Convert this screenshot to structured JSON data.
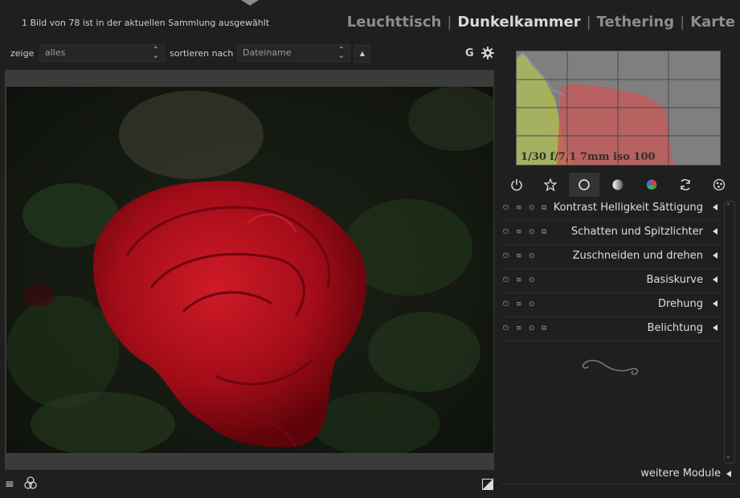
{
  "header": {
    "status": "1 Bild von 78 ist in der aktuellen Sammlung ausgewählt",
    "views": [
      "Leuchttisch",
      "Dunkelkammer",
      "Tethering",
      "Karte"
    ],
    "active_view": "Dunkelkammer",
    "separator": "|"
  },
  "filmstrip_toolbar": {
    "show_label": "zeige",
    "show_value": "alles",
    "sort_label": "sortieren nach",
    "sort_value": "Dateiname",
    "sort_direction": "▲",
    "grouping_label": "G"
  },
  "histogram": {
    "exif": "1/30 f/7,1 7mm iso 100"
  },
  "module_groups": [
    {
      "name": "power-icon"
    },
    {
      "name": "favorites-star-icon"
    },
    {
      "name": "basic-group-circle-icon",
      "active": true
    },
    {
      "name": "tone-group-icon"
    },
    {
      "name": "color-group-icon"
    },
    {
      "name": "correct-group-icon"
    },
    {
      "name": "effects-group-icon"
    }
  ],
  "modules": [
    {
      "name": "Kontrast Helligkeit Sättigung",
      "multi_instance": true
    },
    {
      "name": "Schatten und Spitzlichter",
      "multi_instance": true
    },
    {
      "name": "Zuschneiden und drehen",
      "multi_instance": false
    },
    {
      "name": "Basiskurve",
      "multi_instance": false
    },
    {
      "name": "Drehung",
      "multi_instance": false
    },
    {
      "name": "Belichtung",
      "multi_instance": true
    }
  ],
  "more_modules": "weitere Module",
  "colors": {
    "background": "#1f1f1f",
    "panel_text": "#dedede",
    "inactive_view": "#8d8d8d",
    "active_view": "#d8d8d8",
    "rose": "#b0101c"
  }
}
